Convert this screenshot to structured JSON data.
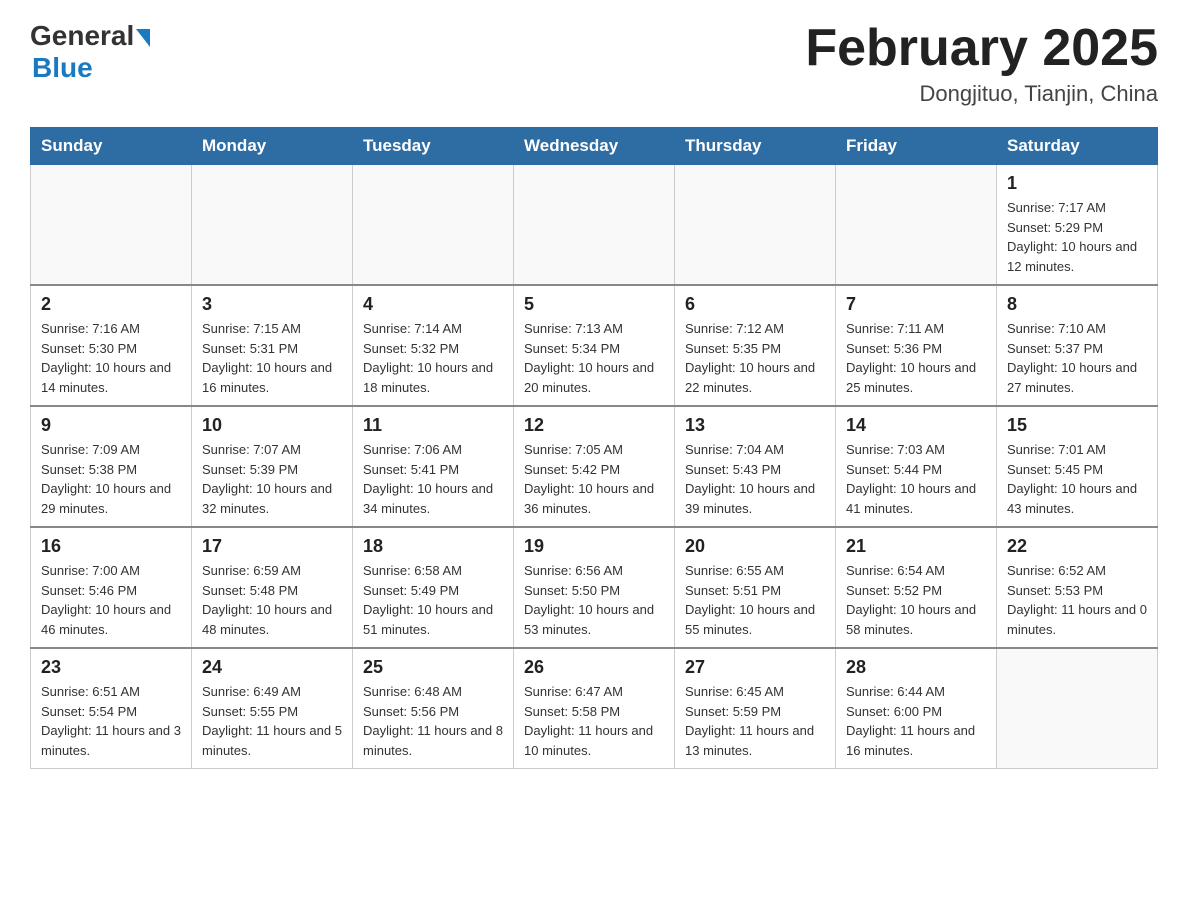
{
  "header": {
    "logo_general": "General",
    "logo_blue": "Blue",
    "month_title": "February 2025",
    "location": "Dongjituo, Tianjin, China"
  },
  "days_of_week": [
    "Sunday",
    "Monday",
    "Tuesday",
    "Wednesday",
    "Thursday",
    "Friday",
    "Saturday"
  ],
  "weeks": [
    [
      {
        "day": "",
        "info": ""
      },
      {
        "day": "",
        "info": ""
      },
      {
        "day": "",
        "info": ""
      },
      {
        "day": "",
        "info": ""
      },
      {
        "day": "",
        "info": ""
      },
      {
        "day": "",
        "info": ""
      },
      {
        "day": "1",
        "info": "Sunrise: 7:17 AM\nSunset: 5:29 PM\nDaylight: 10 hours and 12 minutes."
      }
    ],
    [
      {
        "day": "2",
        "info": "Sunrise: 7:16 AM\nSunset: 5:30 PM\nDaylight: 10 hours and 14 minutes."
      },
      {
        "day": "3",
        "info": "Sunrise: 7:15 AM\nSunset: 5:31 PM\nDaylight: 10 hours and 16 minutes."
      },
      {
        "day": "4",
        "info": "Sunrise: 7:14 AM\nSunset: 5:32 PM\nDaylight: 10 hours and 18 minutes."
      },
      {
        "day": "5",
        "info": "Sunrise: 7:13 AM\nSunset: 5:34 PM\nDaylight: 10 hours and 20 minutes."
      },
      {
        "day": "6",
        "info": "Sunrise: 7:12 AM\nSunset: 5:35 PM\nDaylight: 10 hours and 22 minutes."
      },
      {
        "day": "7",
        "info": "Sunrise: 7:11 AM\nSunset: 5:36 PM\nDaylight: 10 hours and 25 minutes."
      },
      {
        "day": "8",
        "info": "Sunrise: 7:10 AM\nSunset: 5:37 PM\nDaylight: 10 hours and 27 minutes."
      }
    ],
    [
      {
        "day": "9",
        "info": "Sunrise: 7:09 AM\nSunset: 5:38 PM\nDaylight: 10 hours and 29 minutes."
      },
      {
        "day": "10",
        "info": "Sunrise: 7:07 AM\nSunset: 5:39 PM\nDaylight: 10 hours and 32 minutes."
      },
      {
        "day": "11",
        "info": "Sunrise: 7:06 AM\nSunset: 5:41 PM\nDaylight: 10 hours and 34 minutes."
      },
      {
        "day": "12",
        "info": "Sunrise: 7:05 AM\nSunset: 5:42 PM\nDaylight: 10 hours and 36 minutes."
      },
      {
        "day": "13",
        "info": "Sunrise: 7:04 AM\nSunset: 5:43 PM\nDaylight: 10 hours and 39 minutes."
      },
      {
        "day": "14",
        "info": "Sunrise: 7:03 AM\nSunset: 5:44 PM\nDaylight: 10 hours and 41 minutes."
      },
      {
        "day": "15",
        "info": "Sunrise: 7:01 AM\nSunset: 5:45 PM\nDaylight: 10 hours and 43 minutes."
      }
    ],
    [
      {
        "day": "16",
        "info": "Sunrise: 7:00 AM\nSunset: 5:46 PM\nDaylight: 10 hours and 46 minutes."
      },
      {
        "day": "17",
        "info": "Sunrise: 6:59 AM\nSunset: 5:48 PM\nDaylight: 10 hours and 48 minutes."
      },
      {
        "day": "18",
        "info": "Sunrise: 6:58 AM\nSunset: 5:49 PM\nDaylight: 10 hours and 51 minutes."
      },
      {
        "day": "19",
        "info": "Sunrise: 6:56 AM\nSunset: 5:50 PM\nDaylight: 10 hours and 53 minutes."
      },
      {
        "day": "20",
        "info": "Sunrise: 6:55 AM\nSunset: 5:51 PM\nDaylight: 10 hours and 55 minutes."
      },
      {
        "day": "21",
        "info": "Sunrise: 6:54 AM\nSunset: 5:52 PM\nDaylight: 10 hours and 58 minutes."
      },
      {
        "day": "22",
        "info": "Sunrise: 6:52 AM\nSunset: 5:53 PM\nDaylight: 11 hours and 0 minutes."
      }
    ],
    [
      {
        "day": "23",
        "info": "Sunrise: 6:51 AM\nSunset: 5:54 PM\nDaylight: 11 hours and 3 minutes."
      },
      {
        "day": "24",
        "info": "Sunrise: 6:49 AM\nSunset: 5:55 PM\nDaylight: 11 hours and 5 minutes."
      },
      {
        "day": "25",
        "info": "Sunrise: 6:48 AM\nSunset: 5:56 PM\nDaylight: 11 hours and 8 minutes."
      },
      {
        "day": "26",
        "info": "Sunrise: 6:47 AM\nSunset: 5:58 PM\nDaylight: 11 hours and 10 minutes."
      },
      {
        "day": "27",
        "info": "Sunrise: 6:45 AM\nSunset: 5:59 PM\nDaylight: 11 hours and 13 minutes."
      },
      {
        "day": "28",
        "info": "Sunrise: 6:44 AM\nSunset: 6:00 PM\nDaylight: 11 hours and 16 minutes."
      },
      {
        "day": "",
        "info": ""
      }
    ]
  ]
}
